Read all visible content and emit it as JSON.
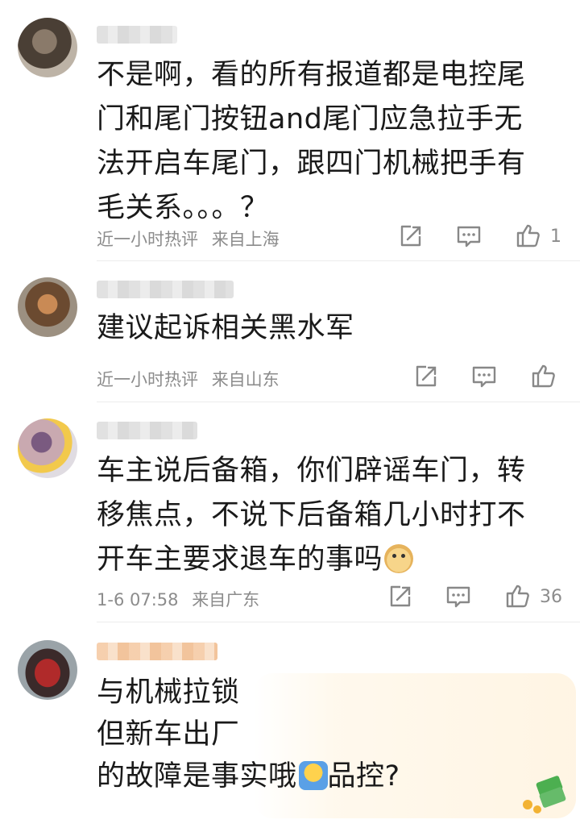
{
  "comments": [
    {
      "text": "不是啊，看的所有报道都是电控尾\n门和尾门按钮and尾门应急拉手无\n法开启车尾门，跟四门机械把手有\n毛关系。。。？",
      "time": "近一小时热评",
      "location": "来自上海",
      "likes": "1"
    },
    {
      "text": "建议起诉相关黑水军",
      "time": "近一小时热评",
      "location": "来自山东",
      "likes": ""
    },
    {
      "text": "车主说后备箱，你们辟谣车门，转\n移焦点，不说下后备箱几小时打不\n开车主要求退车的事吗",
      "emoji": "doge-emoji",
      "time": "1-6 07:58",
      "location": "来自广东",
      "likes": "36"
    },
    {
      "line1": "与机械拉锁",
      "line2": "但新车出厂",
      "line3": "的故障是事实哦",
      "line3_emoji": "shrug-emoji",
      "line3_tail": "品控?"
    }
  ],
  "icons": {
    "repost": "repost-icon",
    "comment": "comment-icon",
    "like": "thumbs-up-icon"
  },
  "colors": {
    "meta_text": "#8c8c8c",
    "body_text": "#1a1a1a",
    "divider": "#ececec"
  }
}
